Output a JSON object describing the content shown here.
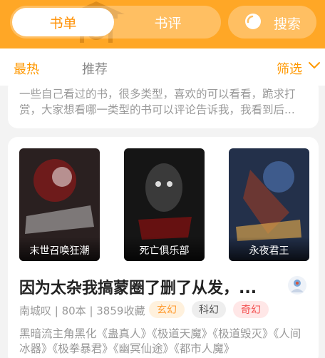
{
  "header": {
    "tabs": [
      {
        "label": "书单",
        "active": true
      },
      {
        "label": "书评",
        "active": false
      }
    ],
    "search_label": "搜索",
    "accent": "#ffa726"
  },
  "filter": {
    "hot": "最热",
    "recommend": "推荐",
    "select": "筛选"
  },
  "card1": {
    "description": "一些自己看过的书，很多类型，喜欢的可以看看，跪求打赏，大家想看哪一类型的书可以评论告诉我，我看到后..."
  },
  "card2": {
    "books": [
      {
        "name": "末世召唤狂潮"
      },
      {
        "name": "死亡俱乐部"
      },
      {
        "name": "永夜君王"
      }
    ],
    "title": "因为太杂我搞蒙圈了删了从发，...",
    "meta": "南城叹 | 80本 | 3859收藏",
    "tags": [
      "玄幻",
      "科幻",
      "奇幻"
    ],
    "summary": "黑暗流主角黑化《蛊真人》《极道天魔》《极道毁灭》《人间冰器》《极拳暴君》《幽冥仙途》《都市人魔》"
  }
}
